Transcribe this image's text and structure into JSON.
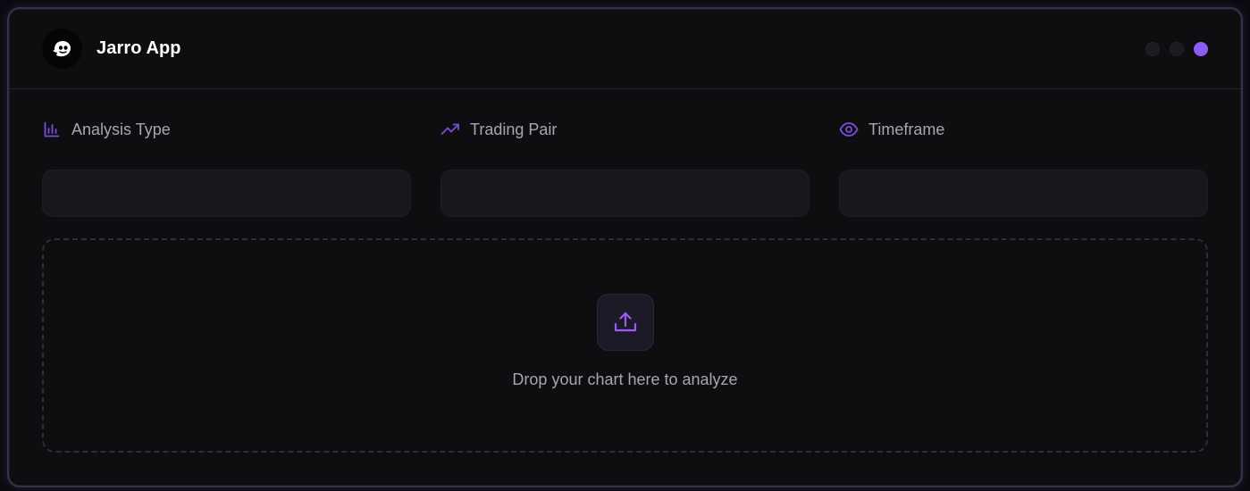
{
  "app": {
    "title": "Jarro App",
    "accent_color": "#8b5cf6"
  },
  "header": {
    "logo_icon": "ghost-icon",
    "status_dots": [
      {
        "state": "inactive"
      },
      {
        "state": "inactive"
      },
      {
        "state": "active"
      }
    ]
  },
  "fields": [
    {
      "label": "Analysis Type",
      "icon": "bar-chart-icon",
      "value": ""
    },
    {
      "label": "Trading Pair",
      "icon": "trending-up-icon",
      "value": ""
    },
    {
      "label": "Timeframe",
      "icon": "eye-icon",
      "value": ""
    }
  ],
  "dropzone": {
    "icon": "upload-icon",
    "text": "Drop your chart here to analyze"
  }
}
